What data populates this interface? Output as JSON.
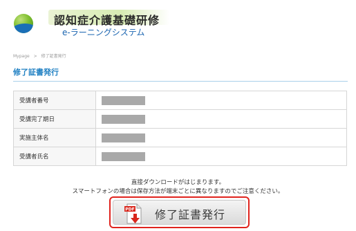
{
  "header": {
    "title": "認知症介護基礎研修",
    "subtitle": "e-ラーニングシステム"
  },
  "breadcrumb": {
    "home": "Mypage",
    "separator": ">",
    "current": "修了証書発行"
  },
  "page": {
    "title": "修了証書発行"
  },
  "info_table": {
    "rows": [
      {
        "label": "受講者番号"
      },
      {
        "label": "受講完了期日"
      },
      {
        "label": "実施主体名"
      },
      {
        "label": "受講者氏名"
      }
    ]
  },
  "notice": {
    "line1": "直接ダウンロードがはじまります。",
    "line2": "スマートフォンの場合は保存方法が端末ごとに異なりますのでご注意ください。"
  },
  "button": {
    "label": "修了証書発行",
    "icon_text": "PDF",
    "icon": "pdf-download-icon"
  },
  "colors": {
    "accent": "#1e7fc2",
    "button_border": "#e0231d",
    "mask": "#a9a9a9"
  }
}
